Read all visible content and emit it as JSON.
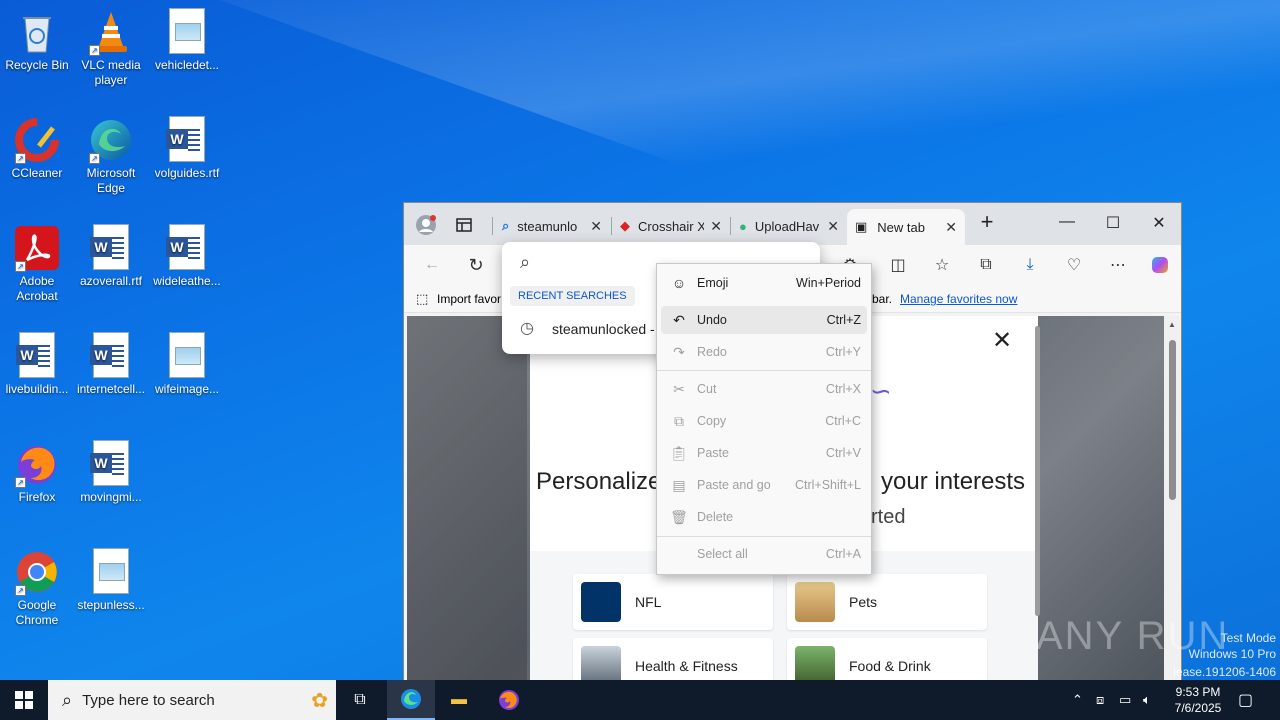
{
  "desktop": {
    "icons": [
      {
        "label": "Recycle Bin"
      },
      {
        "label": "VLC media player"
      },
      {
        "label": "vehicledet..."
      },
      {
        "label": "CCleaner"
      },
      {
        "label": "Microsoft Edge"
      },
      {
        "label": "volguides.rtf"
      },
      {
        "label": "Adobe Acrobat"
      },
      {
        "label": "azoverall.rtf"
      },
      {
        "label": "wideleathe..."
      },
      {
        "label": "livebuildin..."
      },
      {
        "label": "internetcell..."
      },
      {
        "label": "wifeimage..."
      },
      {
        "label": "Firefox"
      },
      {
        "label": "movingmi..."
      },
      {
        "label": "Google Chrome"
      },
      {
        "label": "stepunless..."
      }
    ]
  },
  "browser": {
    "tabs": [
      {
        "label": "steamunlo"
      },
      {
        "label": "Crosshair X"
      },
      {
        "label": "UploadHav"
      },
      {
        "label": "New tab"
      }
    ],
    "favorites": {
      "import_label": "Import favor",
      "bar_text": "bar.",
      "manage_link": "Manage favorites now"
    },
    "address_dropdown": {
      "section_title": "RECENT SEARCHES",
      "items": [
        {
          "label": "steamunlocked -"
        }
      ]
    },
    "page": {
      "heading_left": "Personalize",
      "heading_right": "your interests",
      "subheading": "rted",
      "cards": [
        {
          "label": "NFL"
        },
        {
          "label": "Pets"
        },
        {
          "label": "Health & Fitness"
        },
        {
          "label": "Food & Drink"
        }
      ]
    }
  },
  "context_menu": {
    "items": [
      {
        "label": "Emoji",
        "shortcut": "Win+Period",
        "icon": "emoji-icon"
      },
      {
        "label": "Undo",
        "shortcut": "Ctrl+Z",
        "icon": "undo-icon"
      },
      {
        "label": "Redo",
        "shortcut": "Ctrl+Y",
        "icon": "redo-icon"
      },
      {
        "label": "Cut",
        "shortcut": "Ctrl+X",
        "icon": "cut-icon"
      },
      {
        "label": "Copy",
        "shortcut": "Ctrl+C",
        "icon": "copy-icon"
      },
      {
        "label": "Paste",
        "shortcut": "Ctrl+V",
        "icon": "paste-icon"
      },
      {
        "label": "Paste and go",
        "shortcut": "Ctrl+Shift+L",
        "icon": "paste-go-icon"
      },
      {
        "label": "Delete",
        "shortcut": "",
        "icon": "delete-icon"
      },
      {
        "label": "Select all",
        "shortcut": "Ctrl+A",
        "icon": ""
      }
    ]
  },
  "taskbar": {
    "search_placeholder": "Type here to search",
    "time": "9:53 PM",
    "date": "7/6/2025"
  },
  "watermark": {
    "logo": "ANY RUN",
    "line1": "Test Mode",
    "line2": "Windows 10 Pro",
    "line3": "lease.191206-1406"
  }
}
